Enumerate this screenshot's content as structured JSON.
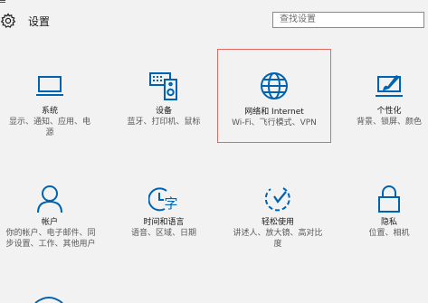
{
  "app": {
    "top_glyph": "≡",
    "title": "设置"
  },
  "search": {
    "placeholder": "查找设置"
  },
  "tiles": [
    {
      "name": "系统",
      "desc": "显示、通知、应用、电源",
      "icon": "laptop-icon"
    },
    {
      "name": "设备",
      "desc": "蓝牙、打印机、鼠标",
      "icon": "keyboard-speaker-icon"
    },
    {
      "name": "网络和 Internet",
      "desc": "Wi-Fi、飞行模式、VPN",
      "icon": "globe-icon",
      "selected": true
    },
    {
      "name": "个性化",
      "desc": "背景、锁屏、颜色",
      "icon": "paint-brush-icon"
    },
    {
      "name": "帐户",
      "desc": "你的帐户、电子邮件、同步设置、工作、其他用户",
      "icon": "person-icon"
    },
    {
      "name": "时间和语言",
      "desc": "语音、区域、日期",
      "icon": "clock-language-icon"
    },
    {
      "name": "轻松使用",
      "desc": "讲述人、放大镜、高对比度",
      "icon": "ease-of-access-icon"
    },
    {
      "name": "隐私",
      "desc": "位置、相机",
      "icon": "lock-icon"
    }
  ],
  "colors": {
    "accent": "#0063b1",
    "selection_border": "#e06b63",
    "background": "#f2f2f2"
  }
}
